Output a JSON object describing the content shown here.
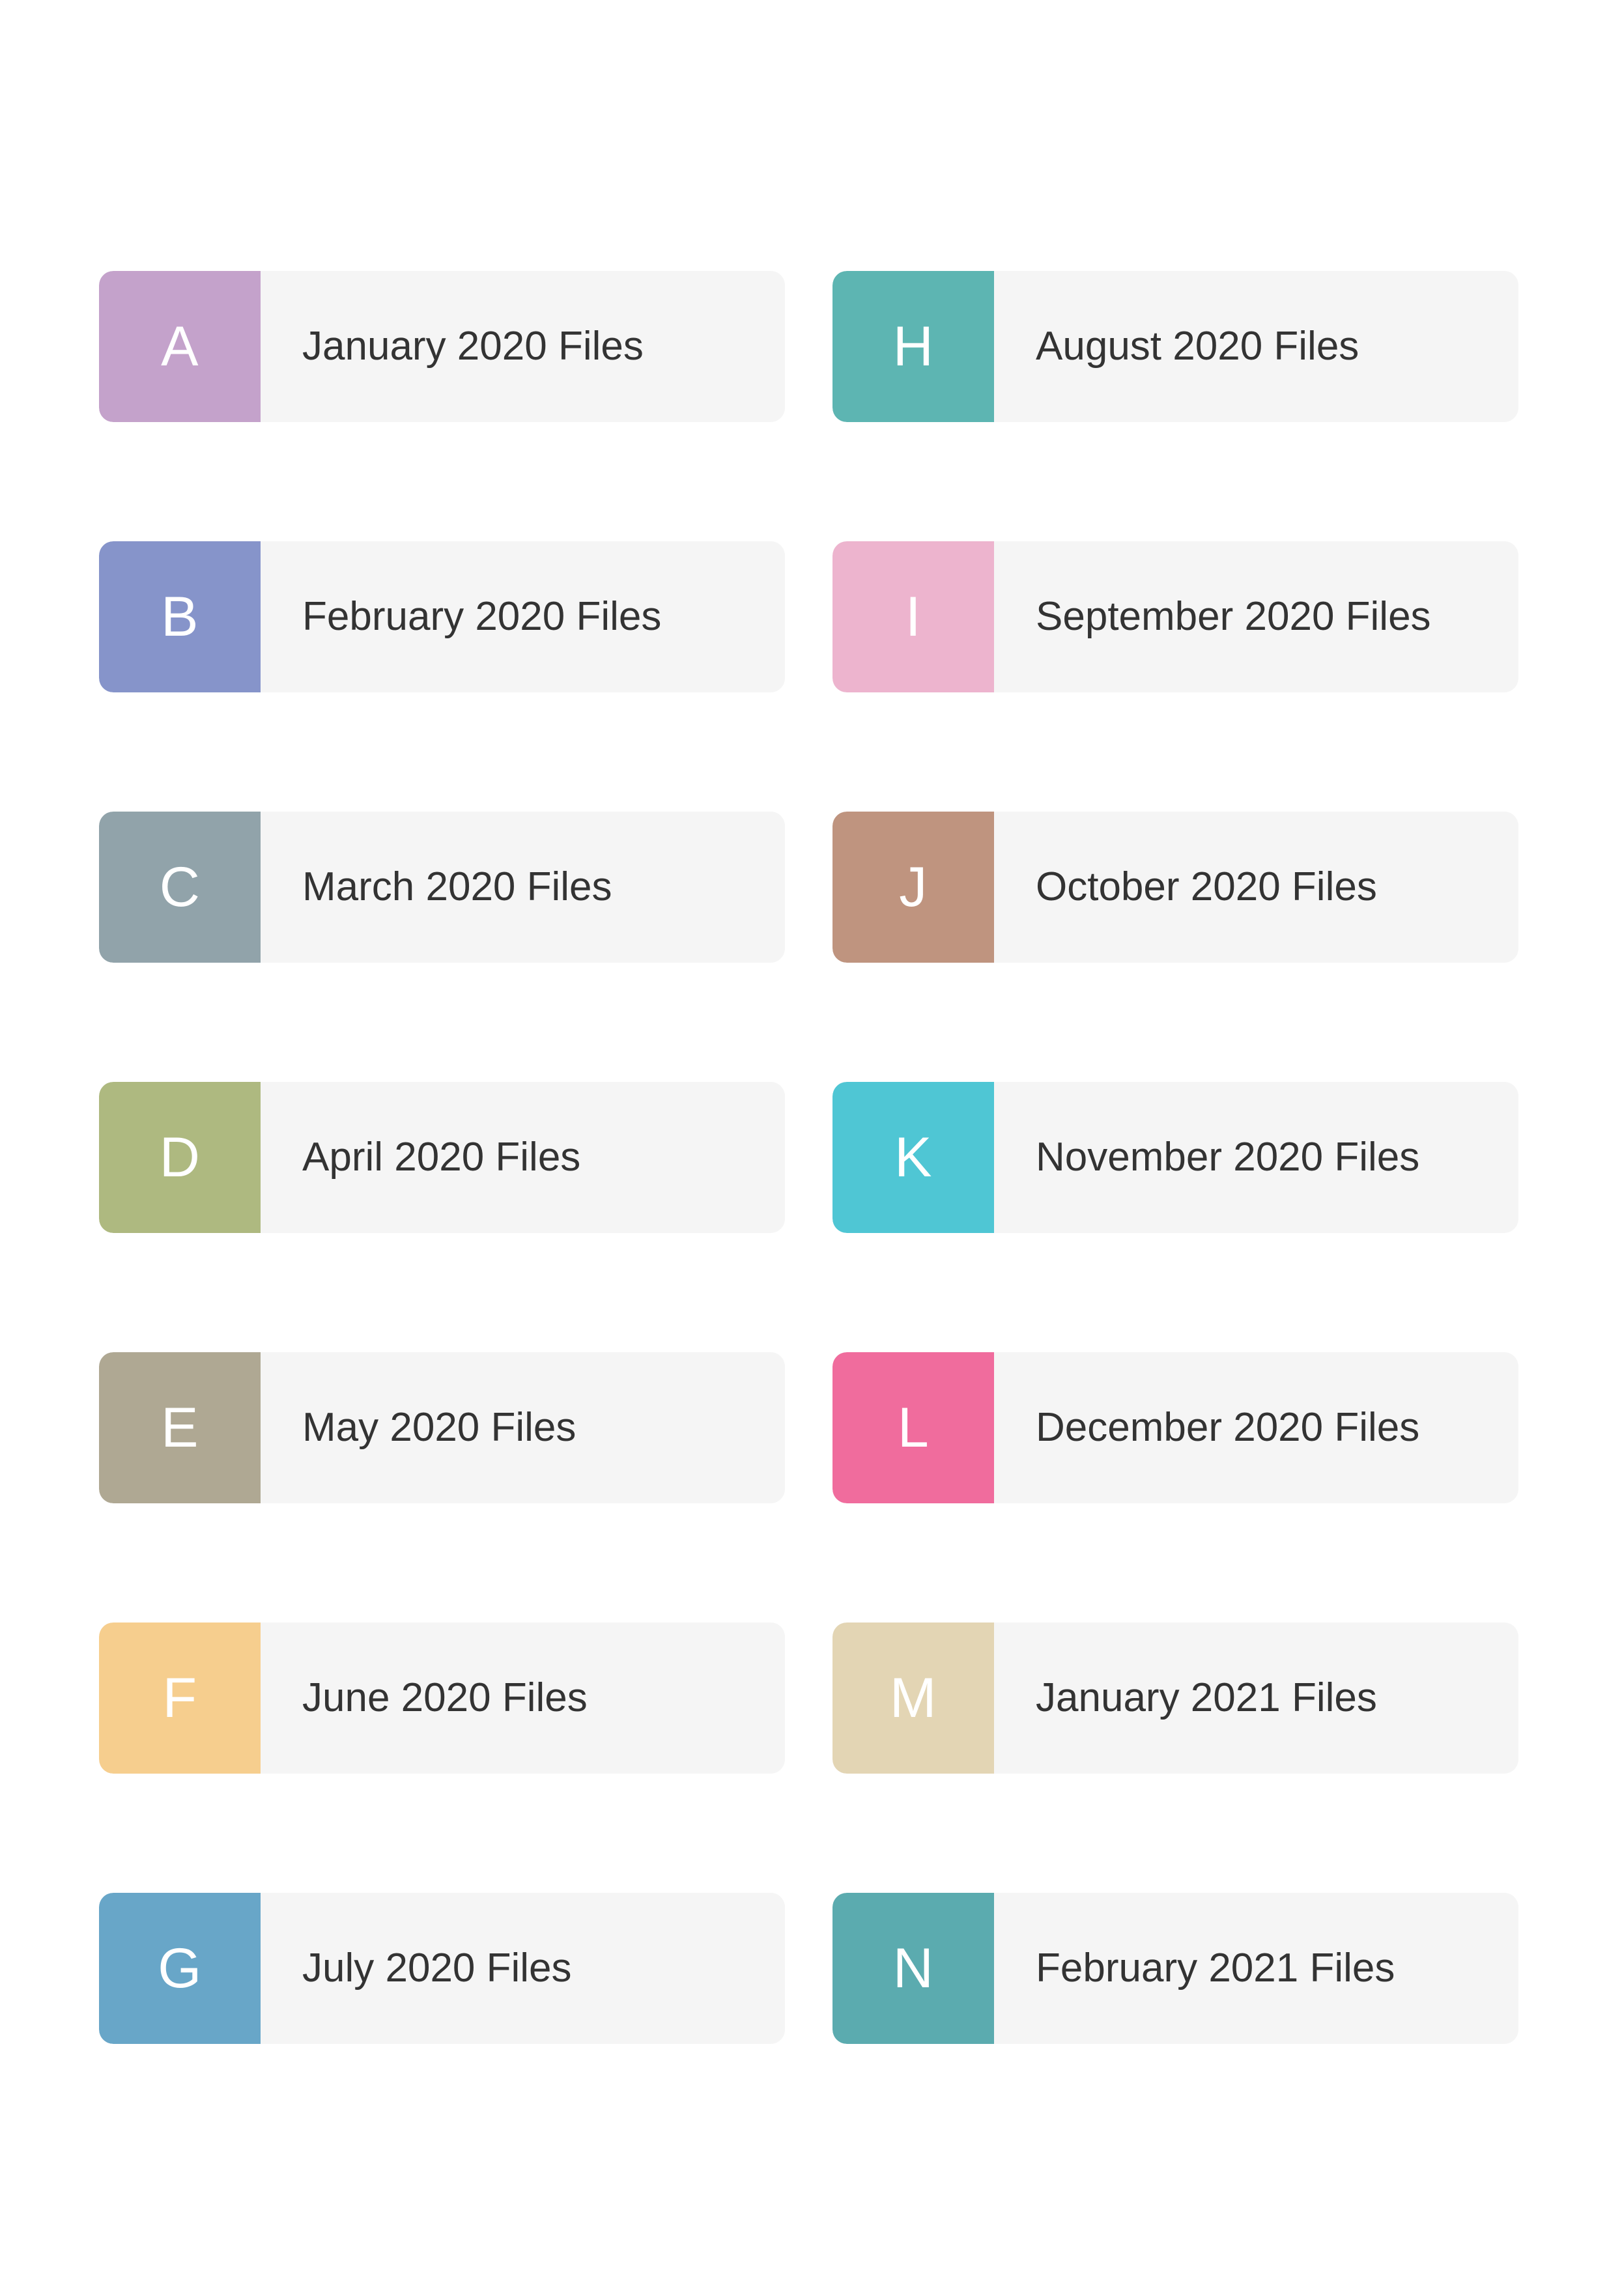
{
  "page": {
    "background_color": "#ffffff",
    "card_body_color": "#f5f5f5",
    "label_text_color": "#333333",
    "badge_letter_color": "#ffffff"
  },
  "folders": {
    "left_column": [
      {
        "letter": "A",
        "label": "January 2020 Files",
        "color": "#c4a2cb"
      },
      {
        "letter": "B",
        "label": "February 2020 Files",
        "color": "#8694ca"
      },
      {
        "letter": "C",
        "label": "March 2020 Files",
        "color": "#91a3aa"
      },
      {
        "letter": "D",
        "label": "April 2020 Files",
        "color": "#aeb980"
      },
      {
        "letter": "E",
        "label": "May 2020 Files",
        "color": "#afa893"
      },
      {
        "letter": "F",
        "label": "June 2020 Files",
        "color": "#f6ce8e"
      },
      {
        "letter": "G",
        "label": "July 2020 Files",
        "color": "#68a6c8"
      }
    ],
    "right_column": [
      {
        "letter": "H",
        "label": "August 2020 Files",
        "color": "#5db5b2"
      },
      {
        "letter": "I",
        "label": "September 2020 Files",
        "color": "#edb4ce"
      },
      {
        "letter": "J",
        "label": "October 2020 Files",
        "color": "#bf947f"
      },
      {
        "letter": "K",
        "label": "November 2020 Files",
        "color": "#4fc6d4"
      },
      {
        "letter": "L",
        "label": "December 2020 Files",
        "color": "#f06c9d"
      },
      {
        "letter": "M",
        "label": "January 2021 Files",
        "color": "#e3d5b4"
      },
      {
        "letter": "N",
        "label": "February 2021 Files",
        "color": "#5babaf"
      }
    ]
  }
}
